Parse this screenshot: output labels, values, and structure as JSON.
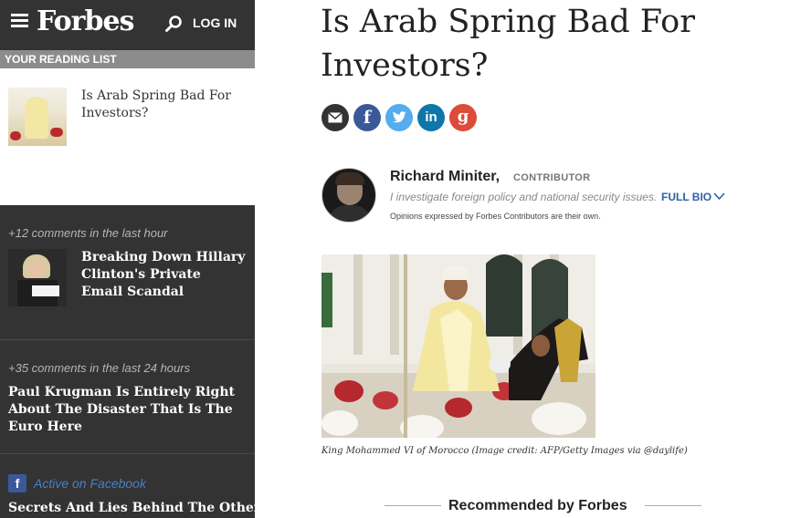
{
  "header": {
    "logo": "Forbes",
    "login_label": "LOG IN"
  },
  "reading_list": {
    "heading": "YOUR READING LIST",
    "items": [
      {
        "title": "Is Arab Spring Bad For Investors?"
      }
    ]
  },
  "trending": [
    {
      "meta": "+12 comments in the last hour",
      "title": "Breaking Down Hillary Clinton's Private Email Scandal"
    },
    {
      "meta": "+35 comments in the last 24 hours",
      "title": "Paul Krugman Is Entirely Right About The Disaster That Is The Euro Here"
    }
  ],
  "facebook": {
    "badge": "f",
    "label": "Active on Facebook",
    "title": "Secrets And Lies Behind The Other"
  },
  "article": {
    "headline": "Is Arab Spring Bad For Investors?",
    "share_icons": [
      "email-icon",
      "facebook-icon",
      "twitter-icon",
      "linkedin-icon",
      "google-plus-icon"
    ],
    "share_glyphs": {
      "facebook": "f",
      "linkedin": "in",
      "google": "g"
    },
    "author": {
      "name": "Richard Miniter,",
      "role": "CONTRIBUTOR",
      "bio": "I investigate foreign policy and national security issues.",
      "full_bio_label": "FULL BIO",
      "disclaimer": "Opinions expressed by Forbes Contributors are their own."
    },
    "image_caption": "King Mohammed VI of Morocco (Image credit: AFP/Getty Images via @daylife)"
  },
  "recommended": {
    "title": "Recommended by Forbes"
  },
  "colors": {
    "sidebar_dark": "#333333",
    "reading_head": "#8c8c8c",
    "email": "#333333",
    "facebook": "#3b5998",
    "twitter": "#55acee",
    "linkedin": "#0e76a8",
    "google": "#dd4b39",
    "full_bio": "#2d5ea8"
  }
}
